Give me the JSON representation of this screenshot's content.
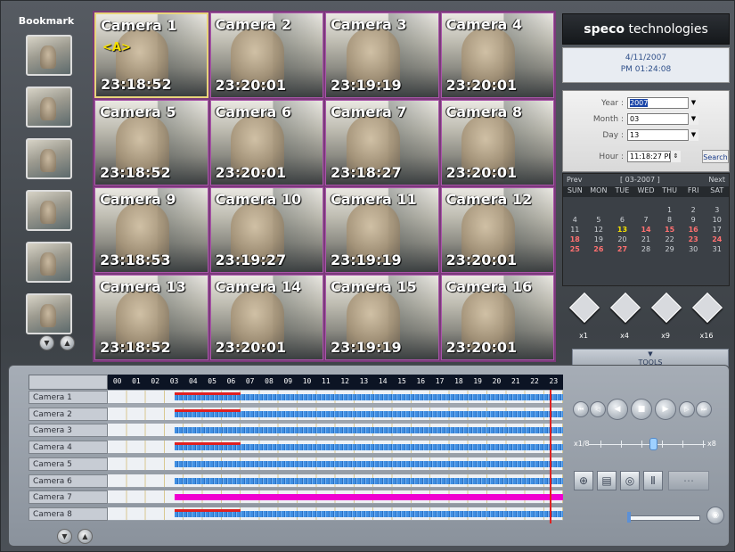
{
  "bookmarks": {
    "title": "Bookmark",
    "count": 6,
    "nav_icons": [
      "scroll-down-icon",
      "scroll-up-icon"
    ]
  },
  "cameras": [
    {
      "name": "Camera 1",
      "time": "23:18:52",
      "tag": "<A>"
    },
    {
      "name": "Camera 2",
      "time": "23:20:01",
      "tag": ""
    },
    {
      "name": "Camera 3",
      "time": "23:19:19",
      "tag": ""
    },
    {
      "name": "Camera 4",
      "time": "23:20:01",
      "tag": ""
    },
    {
      "name": "Camera 5",
      "time": "23:18:52",
      "tag": ""
    },
    {
      "name": "Camera 6",
      "time": "23:20:01",
      "tag": ""
    },
    {
      "name": "Camera 7",
      "time": "23:18:27",
      "tag": ""
    },
    {
      "name": "Camera 8",
      "time": "23:20:01",
      "tag": ""
    },
    {
      "name": "Camera 9",
      "time": "23:18:53",
      "tag": ""
    },
    {
      "name": "Camera 10",
      "time": "23:19:27",
      "tag": ""
    },
    {
      "name": "Camera 11",
      "time": "23:19:19",
      "tag": ""
    },
    {
      "name": "Camera 12",
      "time": "23:20:01",
      "tag": ""
    },
    {
      "name": "Camera 13",
      "time": "23:18:52",
      "tag": ""
    },
    {
      "name": "Camera 14",
      "time": "23:20:01",
      "tag": ""
    },
    {
      "name": "Camera 15",
      "time": "23:19:19",
      "tag": ""
    },
    {
      "name": "Camera 16",
      "time": "23:20:01",
      "tag": ""
    }
  ],
  "brand": {
    "bold": "speco",
    "rest": " technologies"
  },
  "clock": {
    "date": "4/11/2007",
    "time": "PM 01:24:08"
  },
  "search": {
    "year_label": "Year :",
    "year_value": "2007",
    "month_label": "Month :",
    "month_value": "03",
    "day_label": "Day :",
    "day_value": "13",
    "hour_label": "Hour :",
    "hour_value": "11:18:27 PM",
    "button": "Search"
  },
  "calendar": {
    "prev": "Prev",
    "title": "[ 03-2007 ]",
    "next": "Next",
    "days": [
      "SUN",
      "MON",
      "TUE",
      "WED",
      "THU",
      "FRI",
      "SAT"
    ],
    "weeks": [
      [
        "",
        "",
        "",
        "",
        "1",
        "2",
        "3"
      ],
      [
        "4",
        "5",
        "6",
        "7",
        "8",
        "9",
        "10"
      ],
      [
        "11",
        "12",
        "13",
        "14",
        "15",
        "16",
        "17"
      ],
      [
        "18",
        "19",
        "20",
        "21",
        "22",
        "23",
        "24"
      ],
      [
        "25",
        "26",
        "27",
        "28",
        "29",
        "30",
        "31"
      ]
    ],
    "selected": "13",
    "recorded": [
      "14",
      "15",
      "16",
      "18",
      "23",
      "24",
      "25",
      "26",
      "27"
    ],
    "highlight_color": "#f4e000",
    "recorded_color": "#ff7070"
  },
  "views": [
    "x1",
    "x4",
    "x9",
    "x16"
  ],
  "tools_label": "TOOLS",
  "timeline": {
    "hours": [
      "00",
      "01",
      "02",
      "03",
      "04",
      "05",
      "06",
      "07",
      "08",
      "09",
      "10",
      "11",
      "12",
      "13",
      "14",
      "15",
      "16",
      "17",
      "18",
      "19",
      "20",
      "21",
      "22",
      "23"
    ],
    "rows": [
      {
        "label": "Camera 1",
        "red": true,
        "magenta": false
      },
      {
        "label": "Camera 2",
        "red": true,
        "magenta": false
      },
      {
        "label": "Camera 3",
        "red": false,
        "magenta": false
      },
      {
        "label": "Camera 4",
        "red": true,
        "magenta": false
      },
      {
        "label": "Camera 5",
        "red": false,
        "magenta": false
      },
      {
        "label": "Camera 6",
        "red": false,
        "magenta": false
      },
      {
        "label": "Camera 7",
        "red": false,
        "magenta": true
      },
      {
        "label": "Camera 8",
        "red": true,
        "magenta": false
      }
    ],
    "recording_start_hour": 3.5,
    "recording_end_hour": 24,
    "cursor_hour": 23.3,
    "colors": {
      "normal": "#3f8ee2",
      "event": "#e02020",
      "alarm": "#f000d0"
    }
  },
  "playback": {
    "buttons": [
      "skip-start-icon",
      "step-back-icon",
      "rewind-icon",
      "stop-icon",
      "play-icon",
      "step-forward-icon",
      "skip-end-icon"
    ],
    "speed_min": "x1/8",
    "speed_max": "x8"
  },
  "tool_buttons": [
    "zoom-in-icon",
    "film-strip-icon",
    "capture-icon",
    "print-icon",
    "network-icon"
  ],
  "volume": {
    "level": 0.0
  }
}
